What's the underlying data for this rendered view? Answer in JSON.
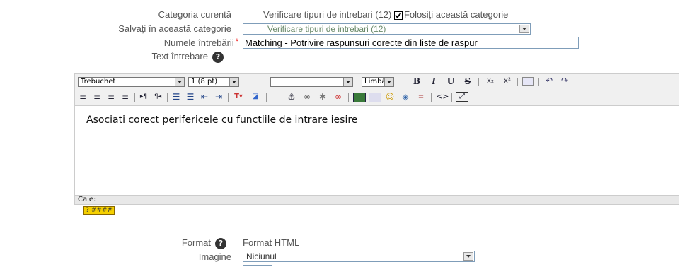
{
  "form": {
    "current_category_label": "Categoria curentă",
    "current_category_value": "Verificare tipuri de intrebari (12)",
    "use_category_label": "Folosiți această categorie",
    "save_in_category_label": "Salvați în această categorie",
    "save_in_category_value": "Verificare tipuri de intrebari (12)",
    "question_name_label": "Numele întrebării",
    "required_mark": "*",
    "question_name_value": "Matching - Potrivire raspunsuri corecte din liste de raspur",
    "question_text_label": "Text întrebare",
    "help_glyph": "?"
  },
  "toolbar": {
    "font_family": "Trebuchet",
    "font_size": "1 (8 pt)",
    "style": "",
    "language": "Limbă",
    "bold": "B",
    "italic": "I",
    "underline": "U",
    "strike": "S",
    "subscript": "x₂",
    "superscript": "x²",
    "undo": "↶",
    "redo": "↷",
    "code": "<>"
  },
  "editor": {
    "content": "Asociati corect perifericele cu functiile de intrare iesire",
    "path_label": "Cale:",
    "help_button_label": "? ####"
  },
  "bottom": {
    "format_label": "Format",
    "format_value": "Format HTML",
    "image_label": "Imagine",
    "image_value": "Niciunul"
  },
  "colors": {
    "accent_border": "#7f9db9",
    "required": "#ee0000",
    "help_yellow": "#f5d000"
  }
}
